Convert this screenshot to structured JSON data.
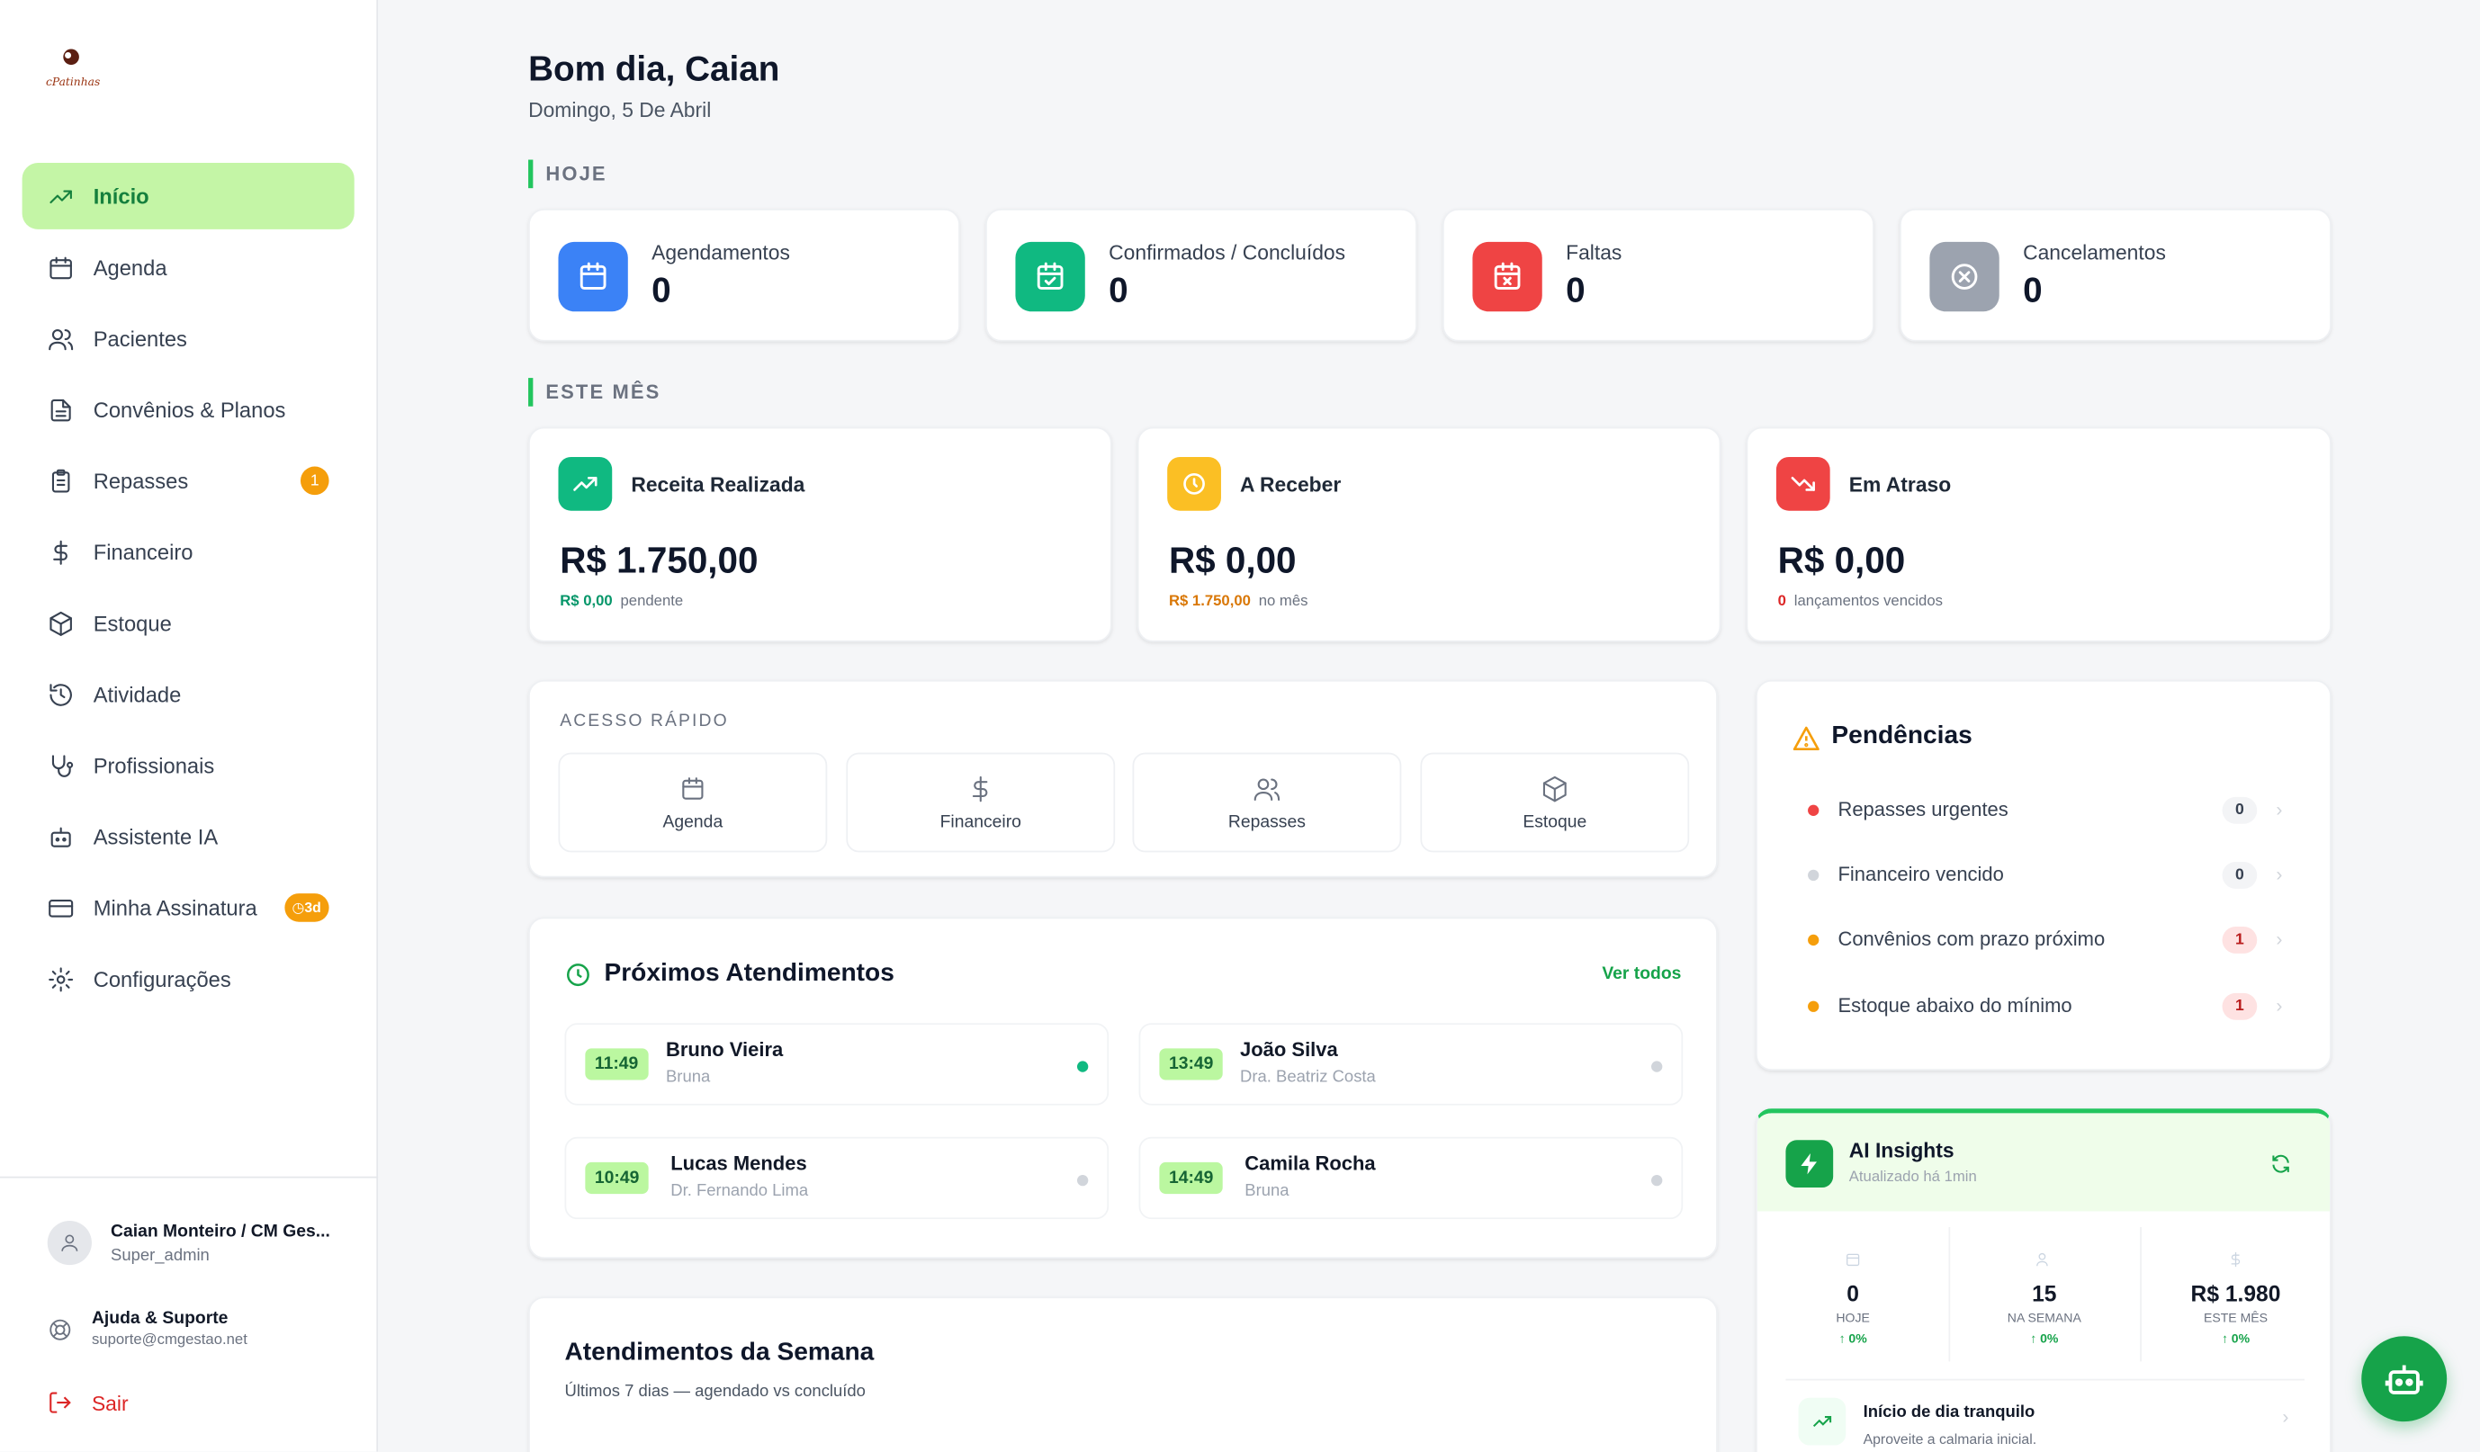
{
  "brand": {
    "logo_text": "cPatinhas"
  },
  "sidebar": {
    "items": [
      {
        "label": "Início"
      },
      {
        "label": "Agenda"
      },
      {
        "label": "Pacientes"
      },
      {
        "label": "Convênios & Planos"
      },
      {
        "label": "Repasses",
        "badge": "1"
      },
      {
        "label": "Financeiro"
      },
      {
        "label": "Estoque"
      },
      {
        "label": "Atividade"
      },
      {
        "label": "Profissionais"
      },
      {
        "label": "Assistente IA"
      },
      {
        "label": "Minha Assinatura",
        "badge": "◷3d"
      },
      {
        "label": "Configurações"
      }
    ],
    "user": {
      "name": "Caian Monteiro / CM Ges...",
      "role": "Super_admin"
    },
    "help": {
      "title": "Ajuda & Suporte",
      "email": "suporte@cmgestao.net"
    },
    "logout": "Sair"
  },
  "header": {
    "greeting": "Bom dia, Caian",
    "date": "Domingo, 5 De Abril"
  },
  "today": {
    "section": "HOJE",
    "stats": [
      {
        "label": "Agendamentos",
        "value": "0",
        "color": "#3b82f6"
      },
      {
        "label": "Confirmados / Concluídos",
        "value": "0",
        "color": "#10b981"
      },
      {
        "label": "Faltas",
        "value": "0",
        "color": "#ef4444"
      },
      {
        "label": "Cancelamentos",
        "value": "0",
        "color": "#9ca3af"
      }
    ]
  },
  "month": {
    "section": "ESTE MÊS",
    "cards": [
      {
        "label": "Receita Realizada",
        "value": "R$ 1.750,00",
        "sub_value": "R$ 0,00",
        "sub_text": "pendente",
        "color": "#10b981"
      },
      {
        "label": "A Receber",
        "value": "R$ 0,00",
        "sub_value": "R$ 1.750,00",
        "sub_text": "no mês",
        "color": "#f59e0b"
      },
      {
        "label": "Em Atraso",
        "value": "R$ 0,00",
        "sub_value": "0",
        "sub_text": "lançamentos vencidos",
        "color": "#ef4444"
      }
    ]
  },
  "quick_access": {
    "title": "ACESSO RÁPIDO",
    "items": [
      {
        "label": "Agenda"
      },
      {
        "label": "Financeiro"
      },
      {
        "label": "Repasses"
      },
      {
        "label": "Estoque"
      }
    ]
  },
  "upcoming": {
    "title": "Próximos Atendimentos",
    "see_all": "Ver todos",
    "items": [
      {
        "time": "11:49",
        "name": "Bruno Vieira",
        "professional": "Bruna"
      },
      {
        "time": "13:49",
        "name": "João Silva",
        "professional": "Dra. Beatriz Costa"
      },
      {
        "time": "10:49",
        "name": "Lucas Mendes",
        "professional": "Dr. Fernando Lima"
      },
      {
        "time": "14:49",
        "name": "Camila Rocha",
        "professional": "Bruna"
      }
    ]
  },
  "week": {
    "title": "Atendimentos da Semana",
    "subtitle": "Últimos 7 dias — agendado vs concluído"
  },
  "pending": {
    "title": "Pendências",
    "items": [
      {
        "label": "Repasses urgentes",
        "count": "0"
      },
      {
        "label": "Financeiro vencido",
        "count": "0"
      },
      {
        "label": "Convênios com prazo próximo",
        "count": "1"
      },
      {
        "label": "Estoque abaixo do mínimo",
        "count": "1"
      }
    ]
  },
  "ai": {
    "title": "AI Insights",
    "updated": "Atualizado há 1min",
    "stats": [
      {
        "value": "0",
        "label": "HOJE",
        "delta": "↑ 0%"
      },
      {
        "value": "15",
        "label": "NA SEMANA",
        "delta": "↑ 0%"
      },
      {
        "value": "R$ 1.980",
        "label": "ESTE MÊS",
        "delta": "↑ 0%"
      }
    ],
    "insight": {
      "title": "Início de dia tranquilo",
      "text": "Aproveite a calmaria inicial."
    }
  }
}
